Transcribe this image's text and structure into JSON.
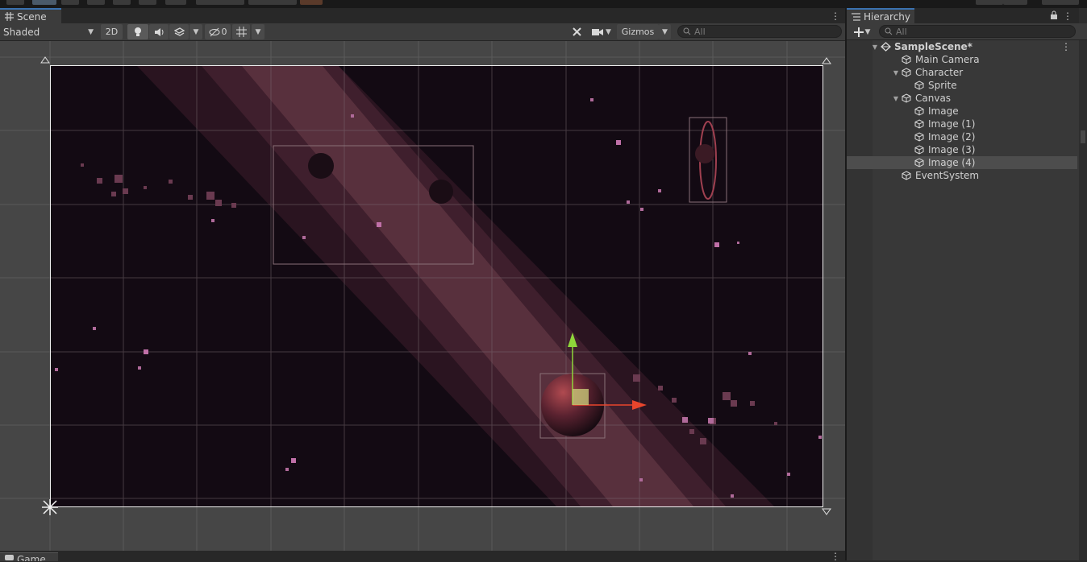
{
  "scene_tab": {
    "title": "Scene"
  },
  "scene_toolbar": {
    "shading_mode": "Shaded",
    "mode_2d": "2D",
    "hidden_count": "0",
    "gizmos_label": "Gizmos",
    "search_placeholder": "All"
  },
  "game_tab": {
    "title": "Game"
  },
  "hierarchy": {
    "title": "Hierarchy",
    "search_placeholder": "All",
    "items": [
      {
        "label": "SampleScene*",
        "depth": 0,
        "expanded": true,
        "type": "scene"
      },
      {
        "label": "Main Camera",
        "depth": 1,
        "type": "object"
      },
      {
        "label": "Character",
        "depth": 1,
        "expanded": true,
        "type": "object"
      },
      {
        "label": "Sprite",
        "depth": 2,
        "type": "object"
      },
      {
        "label": "Canvas",
        "depth": 1,
        "expanded": true,
        "type": "object"
      },
      {
        "label": "Image",
        "depth": 2,
        "type": "object"
      },
      {
        "label": "Image (1)",
        "depth": 2,
        "type": "object"
      },
      {
        "label": "Image (2)",
        "depth": 2,
        "type": "object"
      },
      {
        "label": "Image (3)",
        "depth": 2,
        "type": "object"
      },
      {
        "label": "Image (4)",
        "depth": 2,
        "type": "object",
        "selected": true
      },
      {
        "label": "EventSystem",
        "depth": 1,
        "type": "object"
      }
    ]
  },
  "icons": {
    "scene_tab": "grid-icon",
    "lighting": "light-bulb-icon",
    "audio": "speaker-icon",
    "effects": "effects-icon",
    "visibility": "eye-hidden-icon",
    "grid": "grid-icon",
    "tools": "tools-icon",
    "camera": "camera-icon",
    "search": "search-icon",
    "add": "plus-icon",
    "lock": "lock-icon",
    "menu": "kebab-icon",
    "hierarchy_tab": "list-icon",
    "object": "cube-icon",
    "scene": "unity-scene-icon",
    "move_gizmo": "move-gizmo-icon",
    "anchor": "anchor-icon"
  },
  "colors": {
    "editor_bg": "#383838",
    "tab_accent": "#3a72b0",
    "space_dark": "#120a12",
    "nebula": "#5a2e3a",
    "selection": "#4d4d4d",
    "gizmo_x": "#e8452c",
    "gizmo_y": "#8ed63a"
  }
}
